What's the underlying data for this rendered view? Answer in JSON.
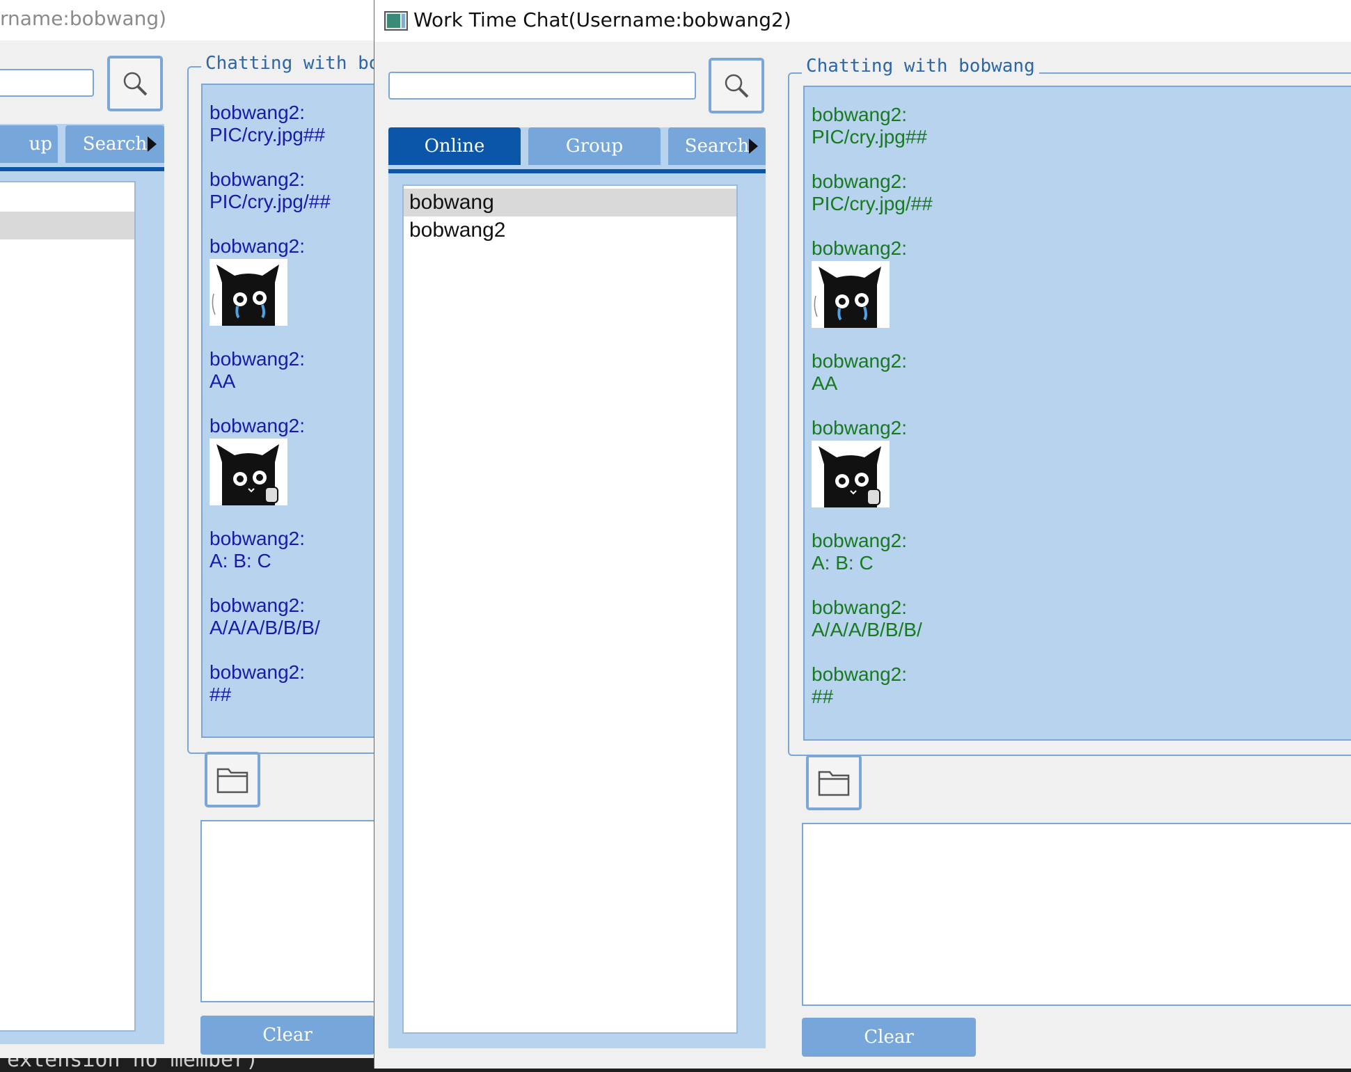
{
  "back_window": {
    "title_fragment": "rname:bobwang)",
    "tabs": [
      "up",
      "Search"
    ],
    "chat_title": "Chatting with bo",
    "messages": [
      {
        "sender": "bobwang2:",
        "text": "PIC/cry.jpg##"
      },
      {
        "sender": "bobwang2:",
        "text": "PIC/cry.jpg/##"
      },
      {
        "sender": "bobwang2:",
        "image": "crying-cat-sticker"
      },
      {
        "sender": "bobwang2:",
        "text": "AA"
      },
      {
        "sender": "bobwang2:",
        "image": "thumbs-up-cat-sticker"
      },
      {
        "sender": "bobwang2:",
        "text": "A:  B:  C"
      },
      {
        "sender": "bobwang2:",
        "text": "A/A/A/B/B/B/"
      },
      {
        "sender": "bobwang2:",
        "text": "##"
      }
    ],
    "clear_label": "Clear"
  },
  "front_window": {
    "title": "Work Time Chat(Username:bobwang2)",
    "search_value": "",
    "tabs": [
      {
        "label": "Online",
        "active": true
      },
      {
        "label": "Group",
        "active": false
      },
      {
        "label": "Search",
        "active": false
      }
    ],
    "users": [
      {
        "name": "bobwang",
        "selected": true
      },
      {
        "name": "bobwang2",
        "selected": false
      }
    ],
    "chat_title": "Chatting with bobwang",
    "messages": [
      {
        "sender": "bobwang2:",
        "text": "PIC/cry.jpg##"
      },
      {
        "sender": "bobwang2:",
        "text": "PIC/cry.jpg/##"
      },
      {
        "sender": "bobwang2:",
        "image": "crying-cat-sticker"
      },
      {
        "sender": "bobwang2:",
        "text": "AA"
      },
      {
        "sender": "bobwang2:",
        "image": "thumbs-up-cat-sticker"
      },
      {
        "sender": "bobwang2:",
        "text": "A:  B:  C"
      },
      {
        "sender": "bobwang2:",
        "text": "A/A/A/B/B/B/"
      },
      {
        "sender": "bobwang2:",
        "text": "##"
      }
    ],
    "message_input_value": "",
    "clear_label": "Clear"
  },
  "console_fragment": "extension no member)",
  "colors": {
    "back_message_text": "#1a1aa8",
    "front_message_text": "#177a1f",
    "tab_active": "#0b56a8",
    "tab_inactive": "#77a7da",
    "panel_bg": "#b8d3ee",
    "border_accent": "#7aa7d8"
  },
  "icons": [
    "search-icon",
    "folder-icon",
    "app-icon",
    "chevron-right-icon"
  ]
}
